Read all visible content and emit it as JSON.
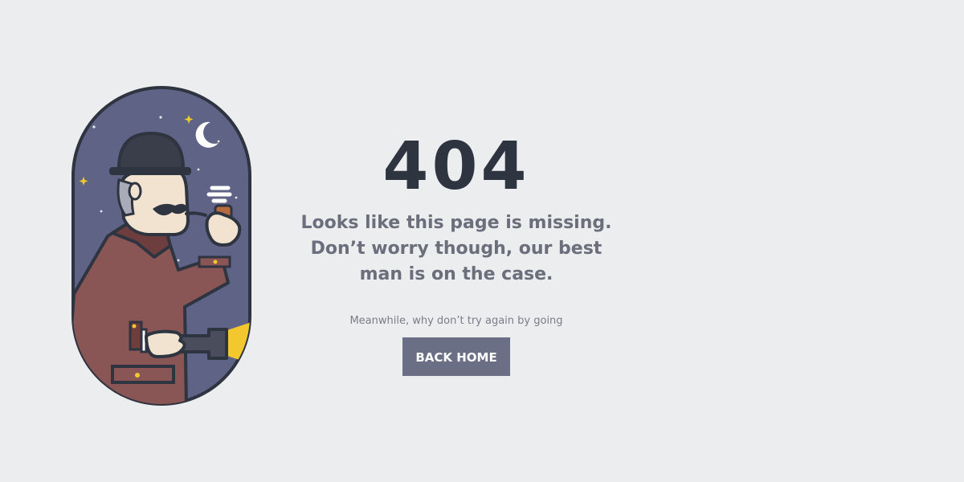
{
  "error": {
    "code": "404",
    "message_lines": [
      "Looks like this page is missing.",
      "Don’t worry though, our best",
      "man is on the case."
    ],
    "subtext": "Meanwhile, why don’t try again by going",
    "button_label": "BACK HOME"
  },
  "colors": {
    "background": "#ECEDEF",
    "heading": "#2E3440",
    "text": "#6B6E7B",
    "button": "#6B6F85",
    "night_sky": "#5F6386",
    "coat": "#8A5555",
    "flashlight_beam": "#F2C82E"
  },
  "illustration": {
    "icon": "detective-icon"
  }
}
